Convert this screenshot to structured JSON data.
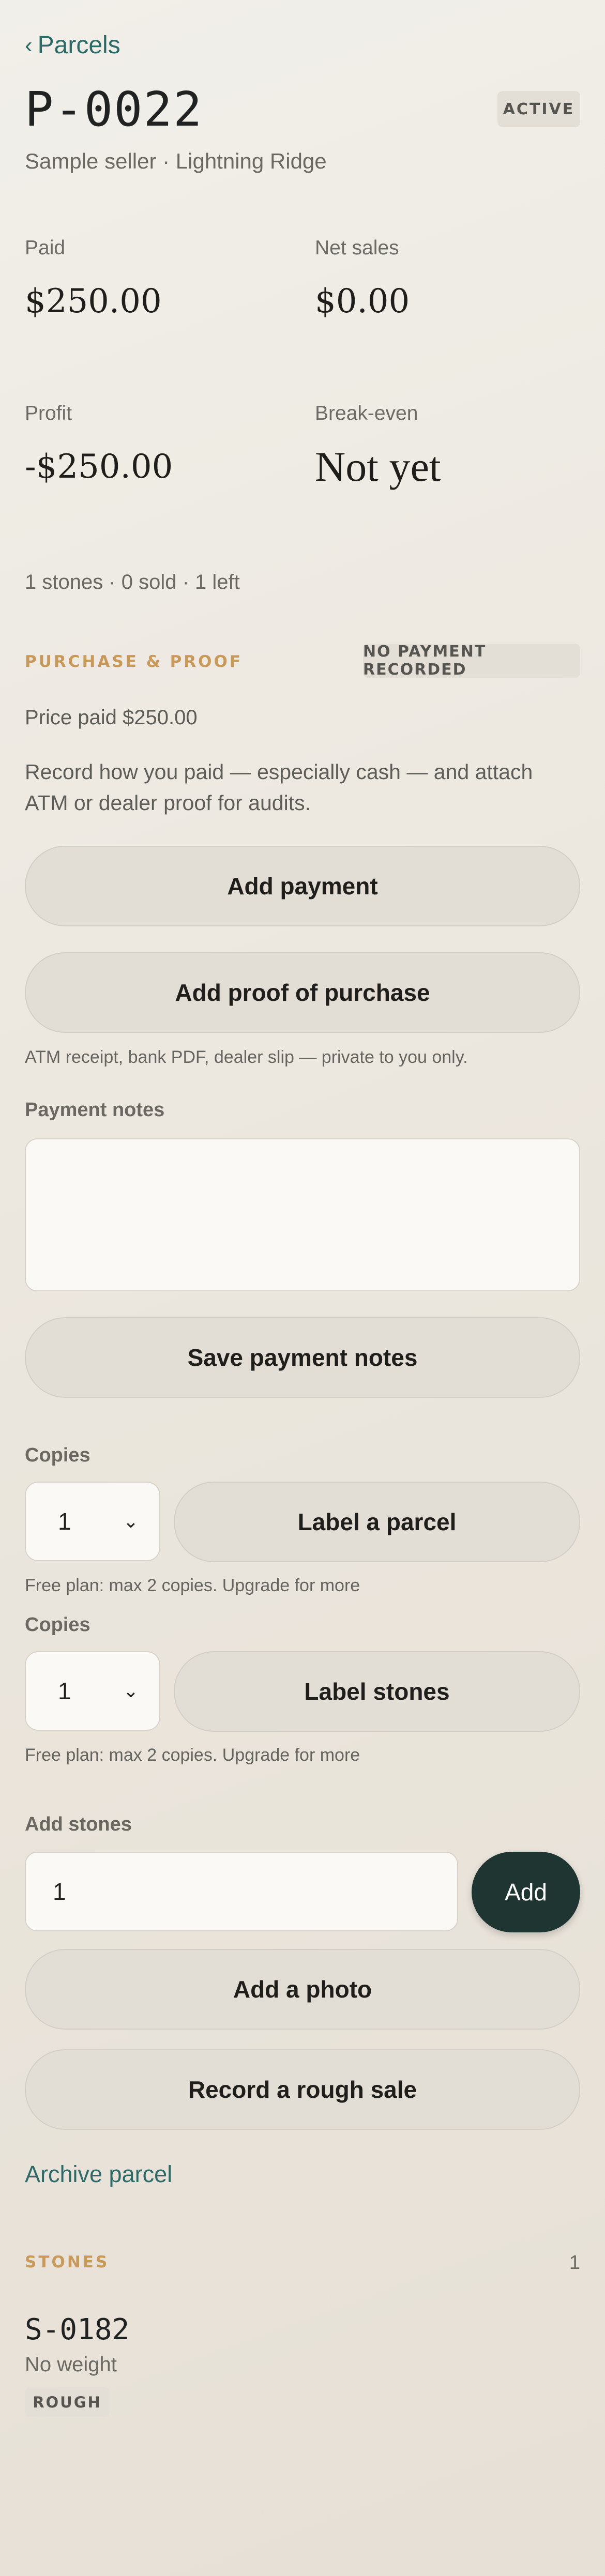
{
  "nav": {
    "back_label": "Parcels"
  },
  "parcel": {
    "code": "P-0022",
    "status": "ACTIVE",
    "subtitle": "Sample seller · Lightning Ridge"
  },
  "stats": {
    "paid_label": "Paid",
    "paid_value": "$250.00",
    "net_sales_label": "Net sales",
    "net_sales_value": "$0.00",
    "profit_label": "Profit",
    "profit_value": "-$250.00",
    "breakeven_label": "Break-even",
    "breakeven_value": "Not yet"
  },
  "counts": "1 stones · 0 sold · 1 left",
  "purchase": {
    "section_title": "PURCHASE & PROOF",
    "payment_badge": "NO PAYMENT RECORDED",
    "price_paid": "Price paid $250.00",
    "description": "Record how you paid — especially cash — and attach ATM or dealer proof for audits.",
    "add_payment": "Add payment",
    "add_proof": "Add proof of purchase",
    "proof_hint": "ATM receipt, bank PDF, dealer slip — private to you only.",
    "notes_label": "Payment notes",
    "notes_value": "",
    "save_notes": "Save payment notes"
  },
  "labels": {
    "parcel_copies_label": "Copies",
    "parcel_copies_value": "1",
    "label_parcel": "Label a parcel",
    "parcel_hint": "Free plan: max 2 copies. Upgrade for more",
    "stones_copies_label": "Copies",
    "stones_copies_value": "1",
    "label_stones": "Label stones",
    "stones_hint": "Free plan: max 2 copies. Upgrade for more"
  },
  "add_stones": {
    "label": "Add stones",
    "value": "1",
    "button": "Add"
  },
  "actions": {
    "add_photo": "Add a photo",
    "record_sale": "Record a rough sale",
    "archive": "Archive parcel"
  },
  "stones": {
    "section_title": "STONES",
    "count": "1",
    "items": [
      {
        "code": "S-0182",
        "weight": "No weight",
        "type": "ROUGH"
      }
    ]
  }
}
